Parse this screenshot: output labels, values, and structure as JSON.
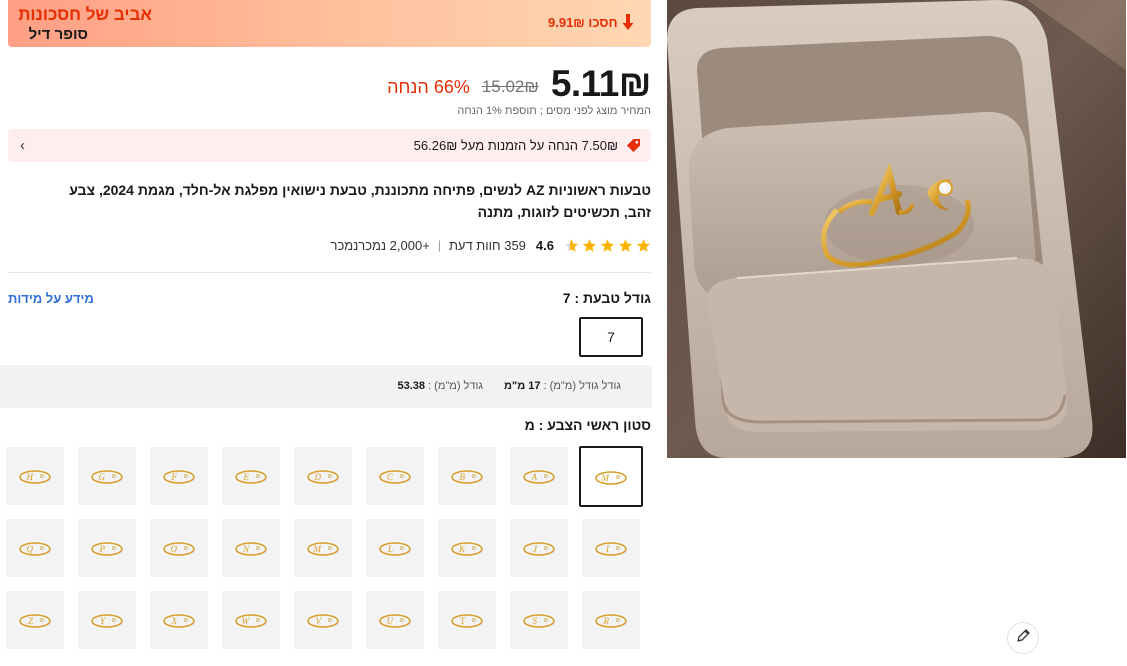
{
  "deal": {
    "title": "אביב של חסכונות",
    "subtitle": "סופר דיל",
    "save": "חסכו 9.91₪"
  },
  "price": {
    "current": "5.11₪",
    "original": "15.02₪",
    "discount": "66% הנחה",
    "tax_note": "המחיר מוצג לפני מסים ; תוספת 1% הנחה"
  },
  "coupon": {
    "text": "7.50₪ הנחה על הזמנות מעל 56.26₪"
  },
  "product": {
    "title": "טבעות ראשוניות AZ לנשים, פתיחה מתכוננת, טבעת נישואין מפלגת אל-חלד, מגמת 2024, צבע זהב, תכשיטים לזוגות, מתנה"
  },
  "rating": {
    "stars": 4.6,
    "value": "4.6",
    "reviews": "359 חוות דעת",
    "separator": "|",
    "sold": "+2,000 נמכרנמכר"
  },
  "size": {
    "label": "גודל טבעת : 7",
    "info_link": "מידע על מידות",
    "selected_option": "7",
    "measure_1_label": "גודל גודל (מ\"מ) :",
    "measure_1_value": "17 מ\"מ",
    "measure_2_label": "גודל (מ\"מ) :",
    "measure_2_value": "53.38"
  },
  "color": {
    "label": "סטון ראשי הצבע : מ",
    "selected_index": 0,
    "swatch_letters": [
      "M",
      "A",
      "B",
      "C",
      "D",
      "E",
      "F",
      "G",
      "H",
      "I",
      "J",
      "K",
      "L",
      "M",
      "N",
      "O",
      "P",
      "Q",
      "R",
      "S",
      "T",
      "U",
      "V",
      "W",
      "X",
      "Y",
      "Z"
    ]
  },
  "colors": {
    "accent_red": "#e62e04",
    "link_blue": "#2e6fd9",
    "star": "#ffb400",
    "ring_gold": "#d9a02c"
  },
  "icons": {
    "deal_arrow": "down-arrow-icon",
    "coupon": "coupon-tag-icon",
    "chevron": "chevron-left-icon",
    "edit": "pencil-icon",
    "star": "star-icon"
  }
}
